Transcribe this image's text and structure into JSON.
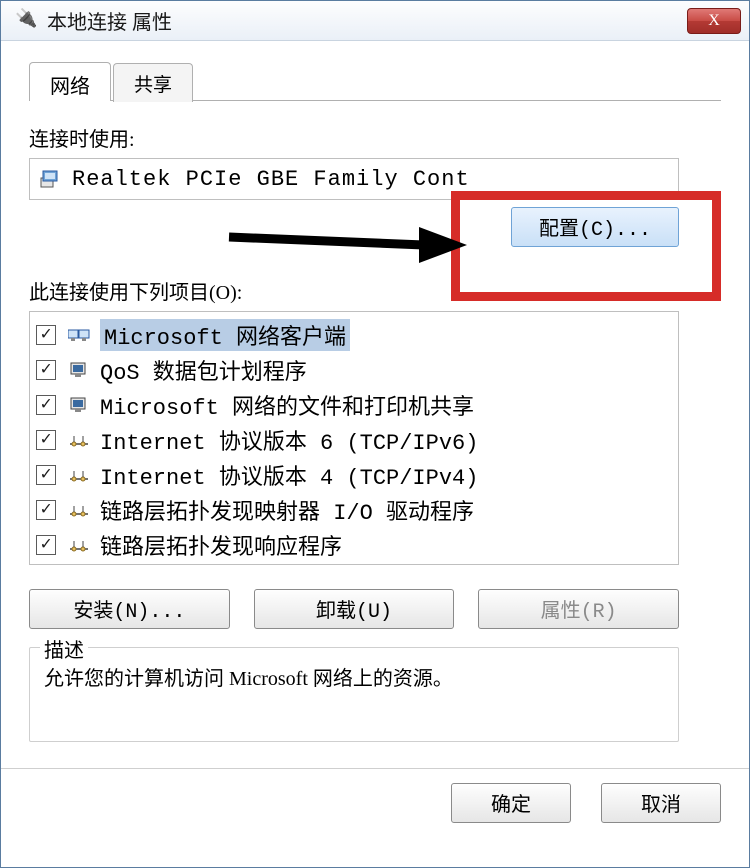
{
  "window": {
    "title": "本地连接 属性",
    "close_x": "X"
  },
  "tabs": {
    "network": "网络",
    "share": "共享"
  },
  "connect_using_label": "连接时使用:",
  "device_name": "Realtek PCIe GBE Family Cont",
  "configure_btn": "配置(C)...",
  "items_label": "此连接使用下列项目(O):",
  "items": [
    {
      "checked": true,
      "icon": "client",
      "label": "Microsoft 网络客户端",
      "highlighted": true
    },
    {
      "checked": true,
      "icon": "service",
      "label": "QoS 数据包计划程序",
      "highlighted": false
    },
    {
      "checked": true,
      "icon": "service",
      "label": "Microsoft 网络的文件和打印机共享",
      "highlighted": false
    },
    {
      "checked": true,
      "icon": "protocol",
      "label": "Internet 协议版本 6 (TCP/IPv6)",
      "highlighted": false
    },
    {
      "checked": true,
      "icon": "protocol",
      "label": "Internet 协议版本 4 (TCP/IPv4)",
      "highlighted": false
    },
    {
      "checked": true,
      "icon": "protocol",
      "label": "链路层拓扑发现映射器 I/O 驱动程序",
      "highlighted": false
    },
    {
      "checked": true,
      "icon": "protocol",
      "label": "链路层拓扑发现响应程序",
      "highlighted": false
    }
  ],
  "buttons": {
    "install": "安装(N)...",
    "uninstall": "卸载(U)",
    "properties": "属性(R)"
  },
  "description": {
    "legend": "描述",
    "text": "允许您的计算机访问 Microsoft 网络上的资源。"
  },
  "dialog": {
    "ok": "确定",
    "cancel": "取消"
  }
}
